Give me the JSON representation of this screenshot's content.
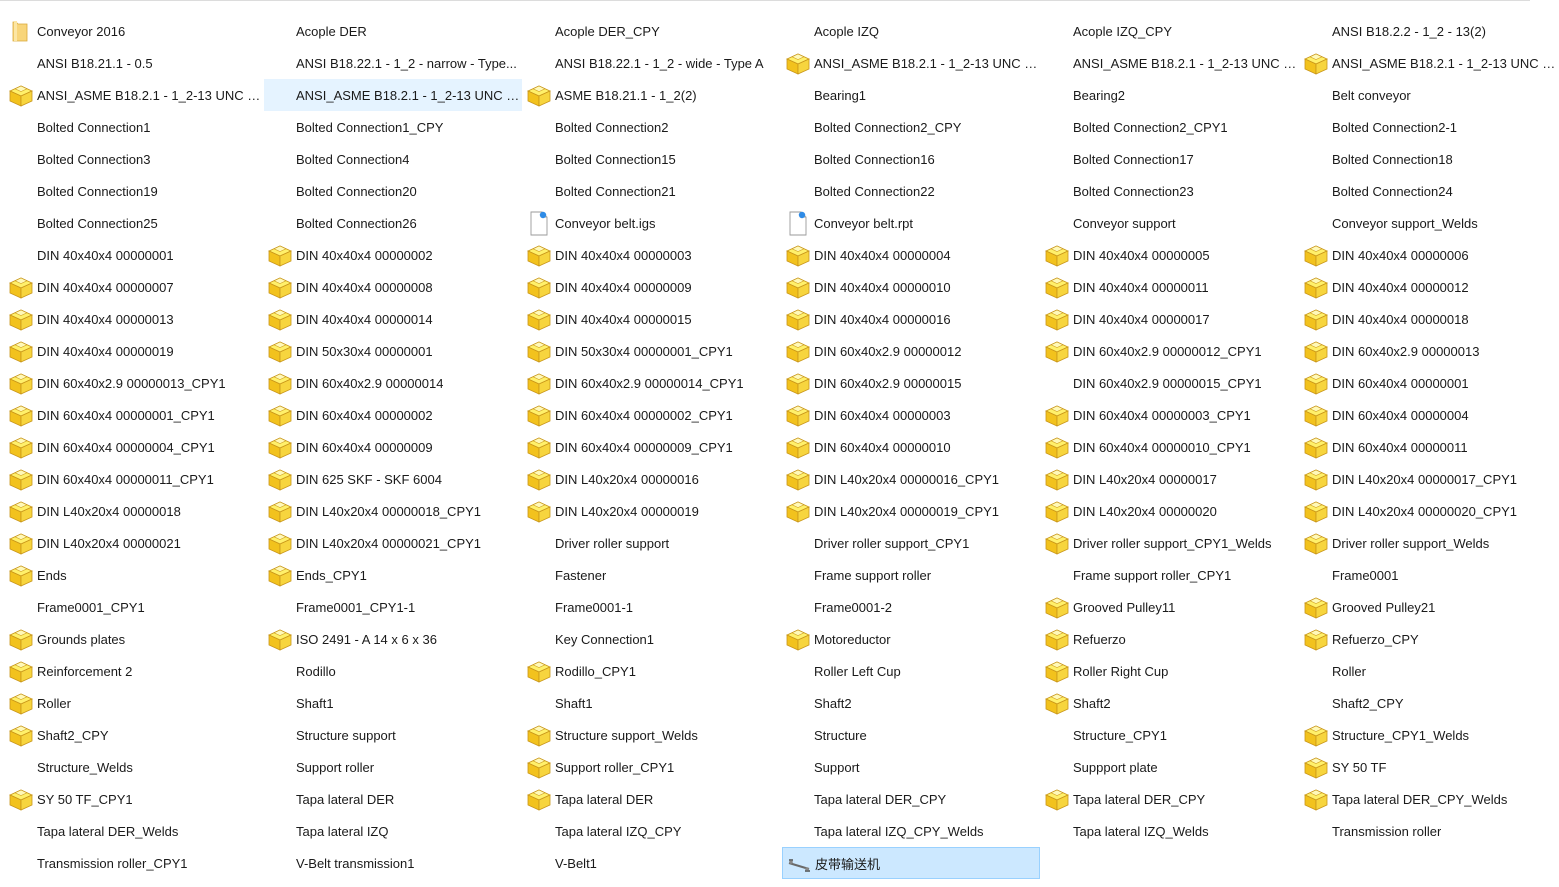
{
  "window": {
    "view": "File Explorer - list view"
  },
  "colors": {
    "part_icon_top": "#fff06a",
    "part_icon_side": "#f2c21d",
    "part_icon_outline": "#c9961a",
    "selection_light": "#e5f3ff",
    "selection_strong": "#cce8ff",
    "selection_border": "#99d1ff"
  },
  "items": [
    {
      "name": "Conveyor 2016",
      "icon": "folder-icon"
    },
    {
      "name": "Acople DER",
      "icon": "none"
    },
    {
      "name": "Acople DER_CPY",
      "icon": "none"
    },
    {
      "name": "Acople IZQ",
      "icon": "none"
    },
    {
      "name": "Acople IZQ_CPY",
      "icon": "none"
    },
    {
      "name": "ANSI B18.2.2 - 1_2 - 13(2)",
      "icon": "none"
    },
    {
      "name": "ANSI B18.21.1 - 0.5",
      "icon": "none"
    },
    {
      "name": "ANSI B18.22.1 - 1_2 - narrow - Type...",
      "icon": "none"
    },
    {
      "name": "ANSI B18.22.1 - 1_2 - wide - Type A",
      "icon": "none"
    },
    {
      "name": "ANSI_ASME B18.2.1 - 1_2-13 UNC - ...",
      "icon": "part-icon"
    },
    {
      "name": "ANSI_ASME B18.2.1 - 1_2-13 UNC - ...",
      "icon": "none"
    },
    {
      "name": "ANSI_ASME B18.2.1 - 1_2-13 UNC - ...",
      "icon": "part-icon"
    },
    {
      "name": "ANSI_ASME B18.2.1 - 1_2-13 UNC - ...",
      "icon": "part-icon"
    },
    {
      "name": "ANSI_ASME B18.2.1 - 1_2-13 UNC - ...",
      "icon": "none",
      "state": "sel-light"
    },
    {
      "name": "ASME B18.21.1 - 1_2(2)",
      "icon": "part-icon"
    },
    {
      "name": "Bearing1",
      "icon": "none"
    },
    {
      "name": "Bearing2",
      "icon": "none"
    },
    {
      "name": "Belt conveyor",
      "icon": "none"
    },
    {
      "name": "Bolted Connection1",
      "icon": "none"
    },
    {
      "name": "Bolted Connection1_CPY",
      "icon": "none"
    },
    {
      "name": "Bolted Connection2",
      "icon": "none"
    },
    {
      "name": "Bolted Connection2_CPY",
      "icon": "none"
    },
    {
      "name": "Bolted Connection2_CPY1",
      "icon": "none"
    },
    {
      "name": "Bolted Connection2-1",
      "icon": "none"
    },
    {
      "name": "Bolted Connection3",
      "icon": "none"
    },
    {
      "name": "Bolted Connection4",
      "icon": "none"
    },
    {
      "name": "Bolted Connection15",
      "icon": "none"
    },
    {
      "name": "Bolted Connection16",
      "icon": "none"
    },
    {
      "name": "Bolted Connection17",
      "icon": "none"
    },
    {
      "name": "Bolted Connection18",
      "icon": "none"
    },
    {
      "name": "Bolted Connection19",
      "icon": "none"
    },
    {
      "name": "Bolted Connection20",
      "icon": "none"
    },
    {
      "name": "Bolted Connection21",
      "icon": "none"
    },
    {
      "name": "Bolted Connection22",
      "icon": "none"
    },
    {
      "name": "Bolted Connection23",
      "icon": "none"
    },
    {
      "name": "Bolted Connection24",
      "icon": "none"
    },
    {
      "name": "Bolted Connection25",
      "icon": "none"
    },
    {
      "name": "Bolted Connection26",
      "icon": "none"
    },
    {
      "name": "Conveyor belt.igs",
      "icon": "doc-icon"
    },
    {
      "name": "Conveyor belt.rpt",
      "icon": "doc-icon"
    },
    {
      "name": "Conveyor support",
      "icon": "none"
    },
    {
      "name": "Conveyor support_Welds",
      "icon": "none"
    },
    {
      "name": "DIN 40x40x4 00000001",
      "icon": "none"
    },
    {
      "name": "DIN 40x40x4 00000002",
      "icon": "part-icon"
    },
    {
      "name": "DIN 40x40x4 00000003",
      "icon": "part-icon"
    },
    {
      "name": "DIN 40x40x4 00000004",
      "icon": "part-icon"
    },
    {
      "name": "DIN 40x40x4 00000005",
      "icon": "part-icon"
    },
    {
      "name": "DIN 40x40x4 00000006",
      "icon": "part-icon"
    },
    {
      "name": "DIN 40x40x4 00000007",
      "icon": "part-icon"
    },
    {
      "name": "DIN 40x40x4 00000008",
      "icon": "part-icon"
    },
    {
      "name": "DIN 40x40x4 00000009",
      "icon": "part-icon"
    },
    {
      "name": "DIN 40x40x4 00000010",
      "icon": "part-icon"
    },
    {
      "name": "DIN 40x40x4 00000011",
      "icon": "part-icon"
    },
    {
      "name": "DIN 40x40x4 00000012",
      "icon": "part-icon"
    },
    {
      "name": "DIN 40x40x4 00000013",
      "icon": "part-icon"
    },
    {
      "name": "DIN 40x40x4 00000014",
      "icon": "part-icon"
    },
    {
      "name": "DIN 40x40x4 00000015",
      "icon": "part-icon"
    },
    {
      "name": "DIN 40x40x4 00000016",
      "icon": "part-icon"
    },
    {
      "name": "DIN 40x40x4 00000017",
      "icon": "part-icon"
    },
    {
      "name": "DIN 40x40x4 00000018",
      "icon": "part-icon"
    },
    {
      "name": "DIN 40x40x4 00000019",
      "icon": "part-icon"
    },
    {
      "name": "DIN 50x30x4 00000001",
      "icon": "part-icon"
    },
    {
      "name": "DIN 50x30x4 00000001_CPY1",
      "icon": "part-icon"
    },
    {
      "name": "DIN 60x40x2.9 00000012",
      "icon": "part-icon"
    },
    {
      "name": "DIN 60x40x2.9 00000012_CPY1",
      "icon": "part-icon"
    },
    {
      "name": "DIN 60x40x2.9 00000013",
      "icon": "part-icon"
    },
    {
      "name": "DIN 60x40x2.9 00000013_CPY1",
      "icon": "part-icon"
    },
    {
      "name": "DIN 60x40x2.9 00000014",
      "icon": "part-icon"
    },
    {
      "name": "DIN 60x40x2.9 00000014_CPY1",
      "icon": "part-icon"
    },
    {
      "name": "DIN 60x40x2.9 00000015",
      "icon": "part-icon"
    },
    {
      "name": "DIN 60x40x2.9 00000015_CPY1",
      "icon": "none"
    },
    {
      "name": "DIN 60x40x4 00000001",
      "icon": "part-icon"
    },
    {
      "name": "DIN 60x40x4 00000001_CPY1",
      "icon": "part-icon"
    },
    {
      "name": "DIN 60x40x4 00000002",
      "icon": "part-icon"
    },
    {
      "name": "DIN 60x40x4 00000002_CPY1",
      "icon": "part-icon"
    },
    {
      "name": "DIN 60x40x4 00000003",
      "icon": "part-icon"
    },
    {
      "name": "DIN 60x40x4 00000003_CPY1",
      "icon": "part-icon"
    },
    {
      "name": "DIN 60x40x4 00000004",
      "icon": "part-icon"
    },
    {
      "name": "DIN 60x40x4 00000004_CPY1",
      "icon": "part-icon"
    },
    {
      "name": "DIN 60x40x4 00000009",
      "icon": "part-icon"
    },
    {
      "name": "DIN 60x40x4 00000009_CPY1",
      "icon": "part-icon"
    },
    {
      "name": "DIN 60x40x4 00000010",
      "icon": "part-icon"
    },
    {
      "name": "DIN 60x40x4 00000010_CPY1",
      "icon": "part-icon"
    },
    {
      "name": "DIN 60x40x4 00000011",
      "icon": "part-icon"
    },
    {
      "name": "DIN 60x40x4 00000011_CPY1",
      "icon": "part-icon"
    },
    {
      "name": "DIN 625 SKF - SKF 6004",
      "icon": "part-icon"
    },
    {
      "name": "DIN L40x20x4 00000016",
      "icon": "part-icon"
    },
    {
      "name": "DIN L40x20x4 00000016_CPY1",
      "icon": "part-icon"
    },
    {
      "name": "DIN L40x20x4 00000017",
      "icon": "part-icon"
    },
    {
      "name": "DIN L40x20x4 00000017_CPY1",
      "icon": "part-icon"
    },
    {
      "name": "DIN L40x20x4 00000018",
      "icon": "part-icon"
    },
    {
      "name": "DIN L40x20x4 00000018_CPY1",
      "icon": "part-icon"
    },
    {
      "name": "DIN L40x20x4 00000019",
      "icon": "part-icon"
    },
    {
      "name": "DIN L40x20x4 00000019_CPY1",
      "icon": "part-icon"
    },
    {
      "name": "DIN L40x20x4 00000020",
      "icon": "part-icon"
    },
    {
      "name": "DIN L40x20x4 00000020_CPY1",
      "icon": "part-icon"
    },
    {
      "name": "DIN L40x20x4 00000021",
      "icon": "part-icon"
    },
    {
      "name": "DIN L40x20x4 00000021_CPY1",
      "icon": "part-icon"
    },
    {
      "name": "Driver roller support",
      "icon": "none"
    },
    {
      "name": "Driver roller support_CPY1",
      "icon": "none"
    },
    {
      "name": "Driver roller support_CPY1_Welds",
      "icon": "part-icon"
    },
    {
      "name": "Driver roller support_Welds",
      "icon": "part-icon"
    },
    {
      "name": "Ends",
      "icon": "part-icon"
    },
    {
      "name": "Ends_CPY1",
      "icon": "part-icon"
    },
    {
      "name": "Fastener",
      "icon": "none"
    },
    {
      "name": "Frame support roller",
      "icon": "none"
    },
    {
      "name": "Frame support roller_CPY1",
      "icon": "none"
    },
    {
      "name": "Frame0001",
      "icon": "none"
    },
    {
      "name": "Frame0001_CPY1",
      "icon": "none"
    },
    {
      "name": "Frame0001_CPY1-1",
      "icon": "none"
    },
    {
      "name": "Frame0001-1",
      "icon": "none"
    },
    {
      "name": "Frame0001-2",
      "icon": "none"
    },
    {
      "name": "Grooved Pulley11",
      "icon": "part-icon"
    },
    {
      "name": "Grooved Pulley21",
      "icon": "part-icon"
    },
    {
      "name": "Grounds plates",
      "icon": "part-icon"
    },
    {
      "name": "ISO 2491 - A  14 x 6 x 36",
      "icon": "part-icon"
    },
    {
      "name": "Key Connection1",
      "icon": "none"
    },
    {
      "name": "Motoreductor",
      "icon": "part-icon"
    },
    {
      "name": "Refuerzo",
      "icon": "part-icon"
    },
    {
      "name": "Refuerzo_CPY",
      "icon": "part-icon"
    },
    {
      "name": "Reinforcement 2",
      "icon": "part-icon"
    },
    {
      "name": "Rodillo",
      "icon": "none"
    },
    {
      "name": "Rodillo_CPY1",
      "icon": "part-icon"
    },
    {
      "name": "Roller Left Cup",
      "icon": "none"
    },
    {
      "name": "Roller Right Cup",
      "icon": "part-icon"
    },
    {
      "name": "Roller",
      "icon": "none"
    },
    {
      "name": "Roller",
      "icon": "part-icon"
    },
    {
      "name": "Shaft1",
      "icon": "none"
    },
    {
      "name": "Shaft1",
      "icon": "none"
    },
    {
      "name": "Shaft2",
      "icon": "none"
    },
    {
      "name": "Shaft2",
      "icon": "part-icon"
    },
    {
      "name": "Shaft2_CPY",
      "icon": "none"
    },
    {
      "name": "Shaft2_CPY",
      "icon": "part-icon"
    },
    {
      "name": "Structure support",
      "icon": "none"
    },
    {
      "name": "Structure support_Welds",
      "icon": "part-icon"
    },
    {
      "name": "Structure",
      "icon": "none"
    },
    {
      "name": "Structure_CPY1",
      "icon": "none"
    },
    {
      "name": "Structure_CPY1_Welds",
      "icon": "part-icon"
    },
    {
      "name": "Structure_Welds",
      "icon": "none"
    },
    {
      "name": "Support roller",
      "icon": "none"
    },
    {
      "name": "Support roller_CPY1",
      "icon": "part-icon"
    },
    {
      "name": "Support",
      "icon": "none"
    },
    {
      "name": "Suppport plate",
      "icon": "none"
    },
    {
      "name": "SY 50 TF",
      "icon": "part-icon"
    },
    {
      "name": "SY 50 TF_CPY1",
      "icon": "part-icon"
    },
    {
      "name": "Tapa lateral DER",
      "icon": "none"
    },
    {
      "name": "Tapa lateral DER",
      "icon": "part-icon"
    },
    {
      "name": "Tapa lateral DER_CPY",
      "icon": "none"
    },
    {
      "name": "Tapa lateral DER_CPY",
      "icon": "part-icon"
    },
    {
      "name": "Tapa lateral DER_CPY_Welds",
      "icon": "part-icon"
    },
    {
      "name": "Tapa lateral DER_Welds",
      "icon": "none"
    },
    {
      "name": "Tapa lateral IZQ",
      "icon": "none"
    },
    {
      "name": "Tapa lateral IZQ_CPY",
      "icon": "none"
    },
    {
      "name": "Tapa lateral IZQ_CPY_Welds",
      "icon": "none"
    },
    {
      "name": "Tapa lateral IZQ_Welds",
      "icon": "none"
    },
    {
      "name": "Transmission roller",
      "icon": "none"
    },
    {
      "name": "Transmission roller_CPY1",
      "icon": "none"
    },
    {
      "name": "V-Belt transmission1",
      "icon": "none"
    },
    {
      "name": "V-Belt1",
      "icon": "none"
    },
    {
      "name": "皮带输送机",
      "icon": "assembly-icon",
      "state": "sel-strong"
    }
  ]
}
